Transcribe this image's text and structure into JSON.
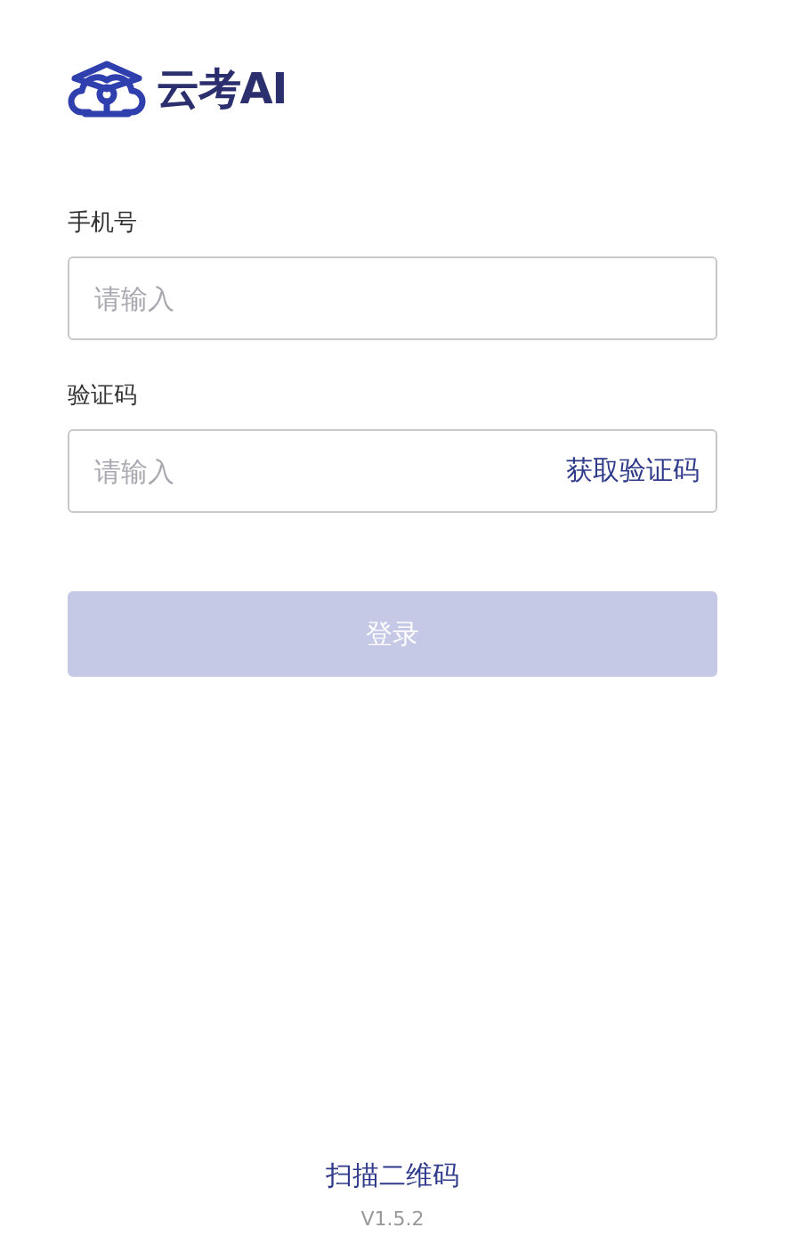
{
  "logo": {
    "text": "云考AI"
  },
  "fields": [
    {
      "label": "手机号",
      "placeholder": "请输入"
    },
    {
      "label": "验证码",
      "placeholder": "请输入",
      "action": "获取验证码"
    }
  ],
  "login_button": {
    "label": "登录",
    "disabled": true
  },
  "footer": {
    "link": "扫描二维码",
    "version": "V1.5.2"
  }
}
